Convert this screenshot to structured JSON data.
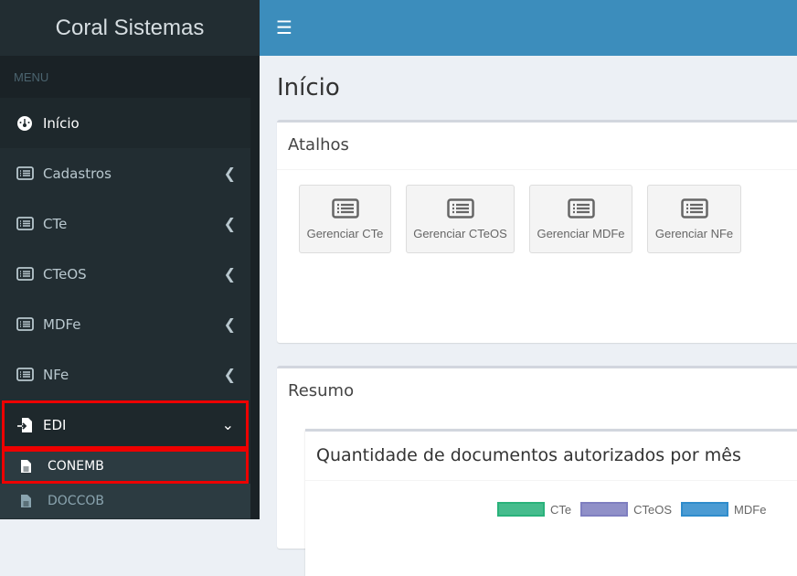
{
  "app": {
    "title": "Coral Sistemas"
  },
  "sidebar": {
    "header": "MENU",
    "items": [
      {
        "label": "Início",
        "icon": "dashboard-icon"
      },
      {
        "label": "Cadastros",
        "icon": "list-icon"
      },
      {
        "label": "CTe",
        "icon": "list-icon"
      },
      {
        "label": "CTeOS",
        "icon": "list-icon"
      },
      {
        "label": "MDFe",
        "icon": "list-icon"
      },
      {
        "label": "NFe",
        "icon": "list-icon"
      },
      {
        "label": "EDI",
        "icon": "file-import-icon"
      }
    ],
    "edi_sub": [
      {
        "label": "CONEMB"
      },
      {
        "label": "DOCCOB"
      }
    ]
  },
  "page": {
    "title": "Início"
  },
  "atalhos": {
    "title": "Atalhos",
    "buttons": [
      {
        "label": "Gerenciar CTe"
      },
      {
        "label": "Gerenciar CTeOS"
      },
      {
        "label": "Gerenciar MDFe"
      },
      {
        "label": "Gerenciar NFe"
      }
    ]
  },
  "resumo": {
    "title": "Resumo",
    "chart_title": "Quantidade de documentos autorizados por mês"
  },
  "chart_data": {
    "type": "bar",
    "title": "Quantidade de documentos autorizados por mês",
    "legend": [
      {
        "name": "CTe",
        "color": "#2ab27b"
      },
      {
        "name": "CTeOS",
        "color": "#7f7fc0"
      },
      {
        "name": "MDFe",
        "color": "#2f8ccc"
      }
    ],
    "series": []
  }
}
